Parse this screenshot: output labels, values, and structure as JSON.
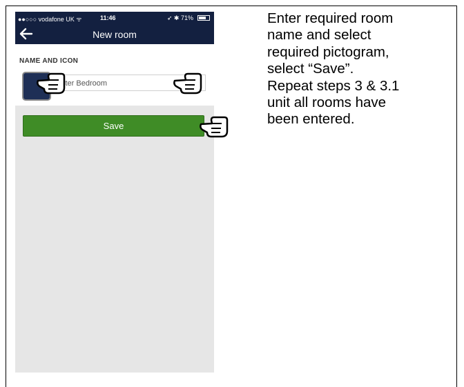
{
  "statusbar": {
    "carrier": "●●○○○ vodafone UK ᯤ",
    "time": "11:46",
    "right": "➶ ✱ 71%",
    "battery_level": 0.71
  },
  "navbar": {
    "title": "New room",
    "back_icon": "arrow-left-icon"
  },
  "form": {
    "section_label": "NAME AND ICON",
    "room_name_value": "ster Bedroom"
  },
  "save_button": {
    "label": "Save"
  },
  "instructions": {
    "lines": [
      "Enter required room",
      "name and select",
      "required pictogram,",
      "select “Save”.",
      "Repeat steps 3 & 3.1",
      "unit all rooms have",
      "been entered."
    ]
  },
  "colors": {
    "header_bg": "#132040",
    "save_green": "#3f8c26",
    "screen_gray": "#e6e6e6"
  }
}
